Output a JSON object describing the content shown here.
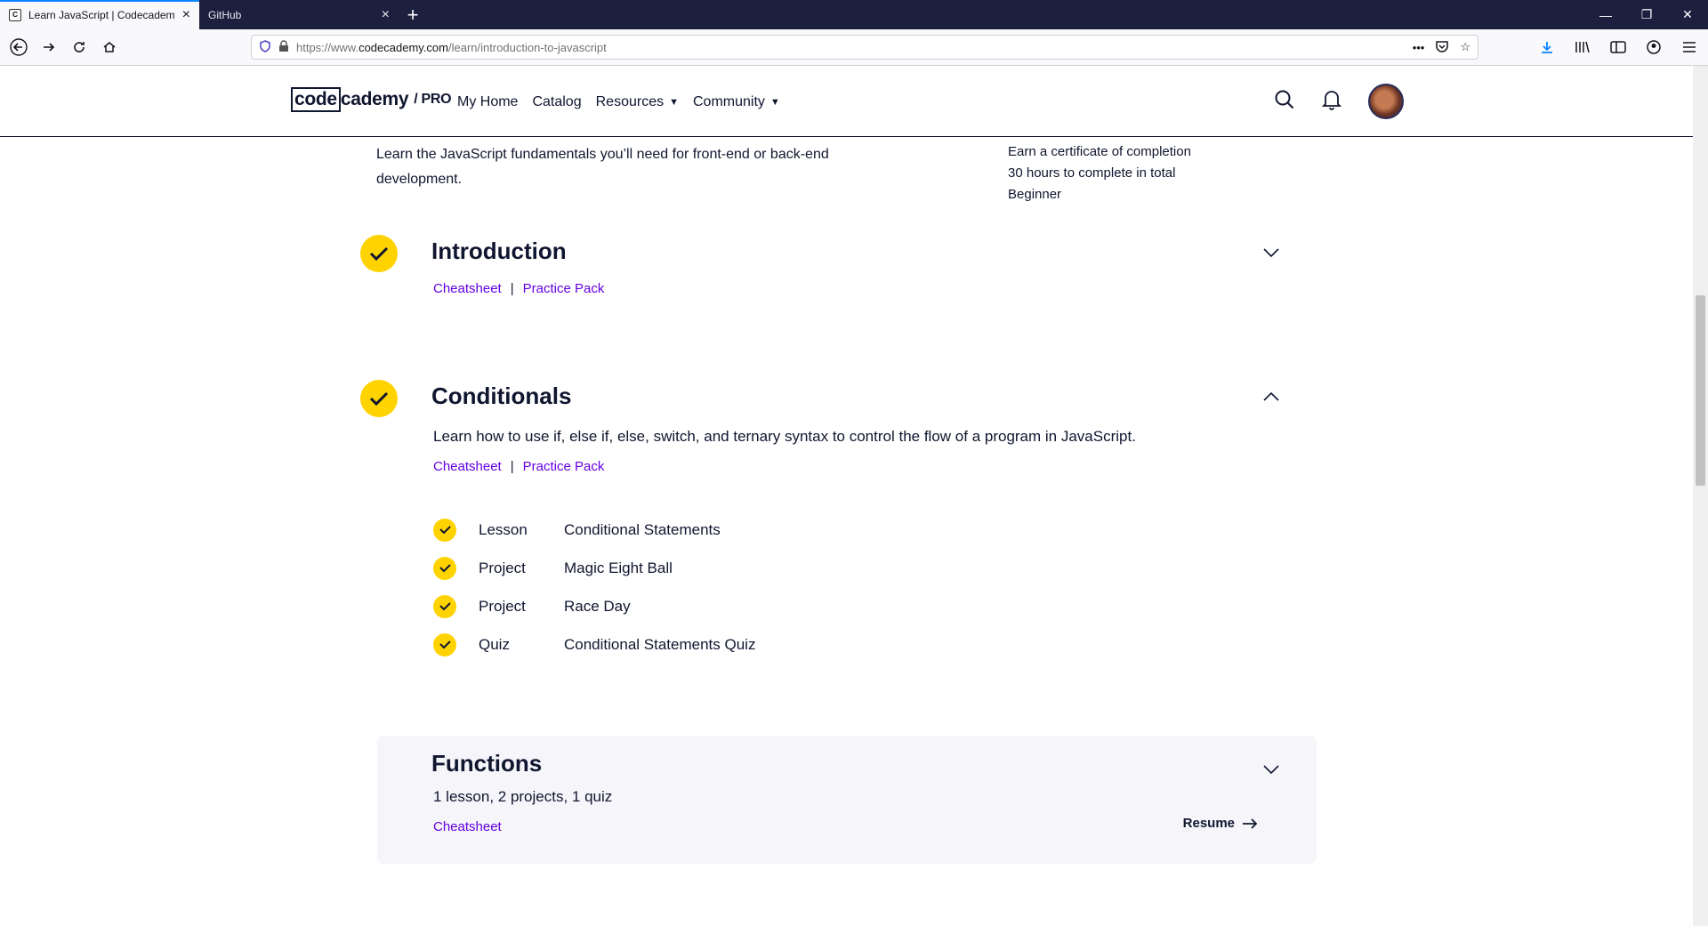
{
  "browser": {
    "tabs": [
      {
        "title": "Learn JavaScript | Codecademy",
        "active": true
      },
      {
        "title": "GitHub",
        "active": false
      }
    ],
    "url_prefix": "https://www.",
    "url_domain": "codecademy.com",
    "url_path": "/learn/introduction-to-javascript"
  },
  "header": {
    "logo_code": "code",
    "logo_rest": "cademy",
    "logo_pro": "/ PRO",
    "nav": [
      "My Home",
      "Catalog",
      "Resources",
      "Community"
    ]
  },
  "course": {
    "description": "Learn the JavaScript fundamentals you’ll need for front-end or back-end development.",
    "meta": [
      "Earn a certificate of completion",
      "30 hours to complete in total",
      "Beginner"
    ]
  },
  "modules": [
    {
      "title": "Introduction",
      "completed": true,
      "expanded": false,
      "links": [
        "Cheatsheet",
        "Practice Pack"
      ]
    },
    {
      "title": "Conditionals",
      "completed": true,
      "expanded": true,
      "description": "Learn how to use if, else if, else, switch, and ternary syntax to control the flow of a program in JavaScript.",
      "links": [
        "Cheatsheet",
        "Practice Pack"
      ],
      "items": [
        {
          "kind": "Lesson",
          "name": "Conditional Statements",
          "completed": true
        },
        {
          "kind": "Project",
          "name": "Magic Eight Ball",
          "completed": true
        },
        {
          "kind": "Project",
          "name": "Race Day",
          "completed": true
        },
        {
          "kind": "Quiz",
          "name": "Conditional Statements Quiz",
          "completed": true
        }
      ]
    },
    {
      "title": "Functions",
      "completed": false,
      "expanded": false,
      "summary": "1 lesson, 2 projects, 1 quiz",
      "links": [
        "Cheatsheet"
      ],
      "action": "Resume"
    }
  ],
  "colors": {
    "accent": "#ffd300",
    "link": "#6400e4",
    "navy": "#10162f",
    "card": "#f5f5fa"
  }
}
